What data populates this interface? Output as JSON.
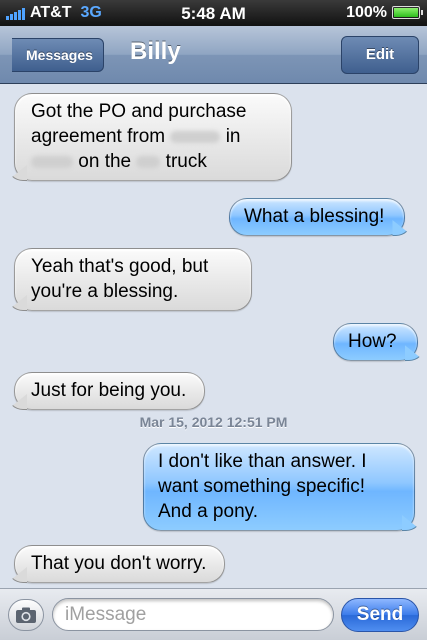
{
  "status_bar": {
    "carrier": "AT&T",
    "network": "3G",
    "time": "5:48 AM",
    "battery_percent": "100%"
  },
  "nav": {
    "back_label": "Messages",
    "title": "Billy",
    "edit_label": "Edit"
  },
  "messages": [
    {
      "direction": "incoming",
      "lines": [
        "Got the PO and purchase",
        "agreement from",
        "in",
        "on the",
        "truck"
      ]
    },
    {
      "direction": "outgoing",
      "text": "What a blessing!"
    },
    {
      "direction": "incoming",
      "lines": [
        "Yeah that's good, but",
        "you're a blessing."
      ]
    },
    {
      "direction": "outgoing",
      "text": "How?"
    },
    {
      "direction": "incoming",
      "text": "Just for being you."
    },
    {
      "direction": "outgoing",
      "lines": [
        "I don't like than answer. I",
        "want something specific!",
        "And a pony."
      ]
    },
    {
      "direction": "incoming",
      "text": "That you don't worry."
    }
  ],
  "timestamp": "Mar 15, 2012 12:51 PM",
  "composer": {
    "placeholder": "iMessage",
    "send_label": "Send",
    "camera_icon": "camera-icon"
  },
  "colors": {
    "background": "#dbe2ed",
    "outgoing_bubble": "#8fc7ff",
    "incoming_bubble": "#e8e8e8",
    "send_button": "#3b7bea"
  }
}
